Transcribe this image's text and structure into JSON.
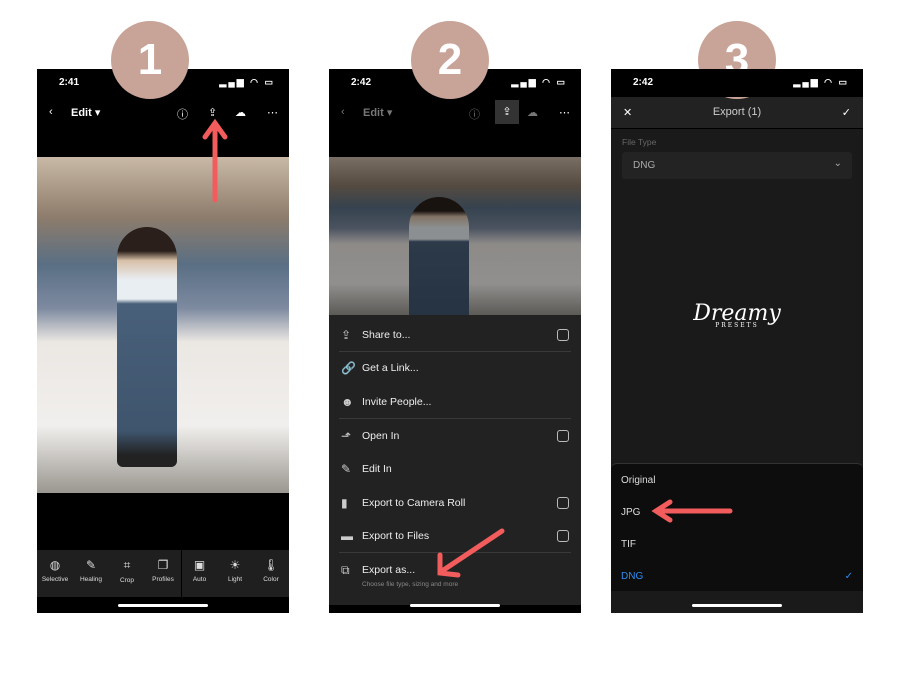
{
  "steps": [
    "1",
    "2",
    "3"
  ],
  "phone1": {
    "time": "2:41",
    "header": "Edit",
    "tools": [
      {
        "icon": "selective-icon",
        "label": "Selective"
      },
      {
        "icon": "healing-icon",
        "label": "Healing"
      },
      {
        "icon": "crop-icon",
        "label": "Crop"
      },
      {
        "icon": "profiles-icon",
        "label": "Profiles"
      },
      {
        "icon": "auto-icon",
        "label": "Auto"
      },
      {
        "icon": "light-icon",
        "label": "Light"
      },
      {
        "icon": "color-icon",
        "label": "Color"
      }
    ]
  },
  "phone2": {
    "time": "2:42",
    "header": "Edit",
    "menu": [
      {
        "label": "Share to...",
        "toggle": true
      },
      {
        "label": "Get a Link...",
        "toggle": false
      },
      {
        "label": "Invite People...",
        "toggle": false
      },
      {
        "label": "Open In",
        "toggle": true
      },
      {
        "label": "Edit In",
        "toggle": false
      },
      {
        "label": "Export to Camera Roll",
        "toggle": true
      },
      {
        "label": "Export to Files",
        "toggle": true
      },
      {
        "label": "Export as...",
        "sub": "Choose file type, sizing and more",
        "toggle": false
      }
    ]
  },
  "phone3": {
    "time": "2:42",
    "title": "Export (1)",
    "file_type_label": "File Type",
    "file_type_value": "DNG",
    "logo": "Dreamy PRESETS",
    "options": [
      "Original",
      "JPG",
      "TIF",
      "DNG"
    ],
    "selected": "DNG",
    "accent": "#2d8cf0"
  },
  "colors": {
    "circle": "#c8a398",
    "arrow": "#f25c5c"
  }
}
